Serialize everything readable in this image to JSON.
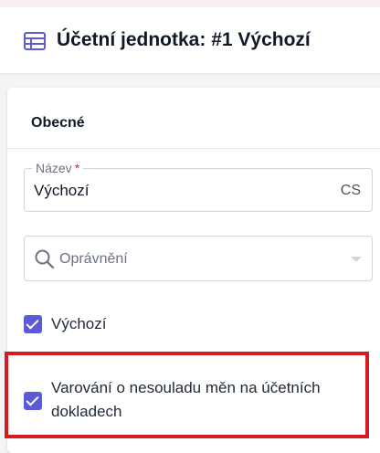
{
  "header": {
    "title": "Účetní jednotka: #1 Výchozí",
    "icon": "table-icon"
  },
  "section": {
    "title": "Obecné"
  },
  "name_field": {
    "label": "Název",
    "required_mark": "*",
    "value": "Výchozí",
    "language": "CS"
  },
  "permissions_field": {
    "placeholder": "Oprávnění",
    "icon": "search-icon"
  },
  "checkboxes": [
    {
      "label": "Výchozí",
      "checked": true
    },
    {
      "label": "Varování o nesouladu měn na účetních dokladech",
      "checked": true
    }
  ],
  "colors": {
    "accent": "#5b5bd6",
    "highlight": "#d71920"
  }
}
